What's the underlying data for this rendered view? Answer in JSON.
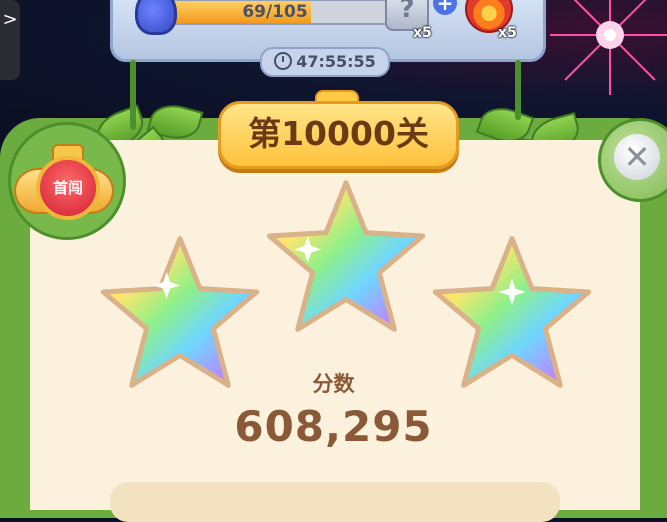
{
  "top_panel": {
    "progress_text": "69/105",
    "progress_value": 69,
    "progress_max": 105,
    "mystery_box_symbol": "?",
    "mystery_box_count": "x5",
    "fire_count": "x5",
    "plus_symbol": "+",
    "timer": "47:55:55"
  },
  "level": {
    "title": "第10000关"
  },
  "medal": {
    "label": "首闯"
  },
  "close_symbol": "✕",
  "result": {
    "stars_earned": 3,
    "stars_total": 3,
    "score_label": "分数",
    "score_value": "608,295"
  },
  "nav": {
    "back_symbol": ">"
  },
  "colors": {
    "frame_green": "#6cab3e",
    "panel_cream": "#fbf1dc",
    "score_brown": "#8a5a38",
    "banner_gold": "#ffc23b"
  }
}
